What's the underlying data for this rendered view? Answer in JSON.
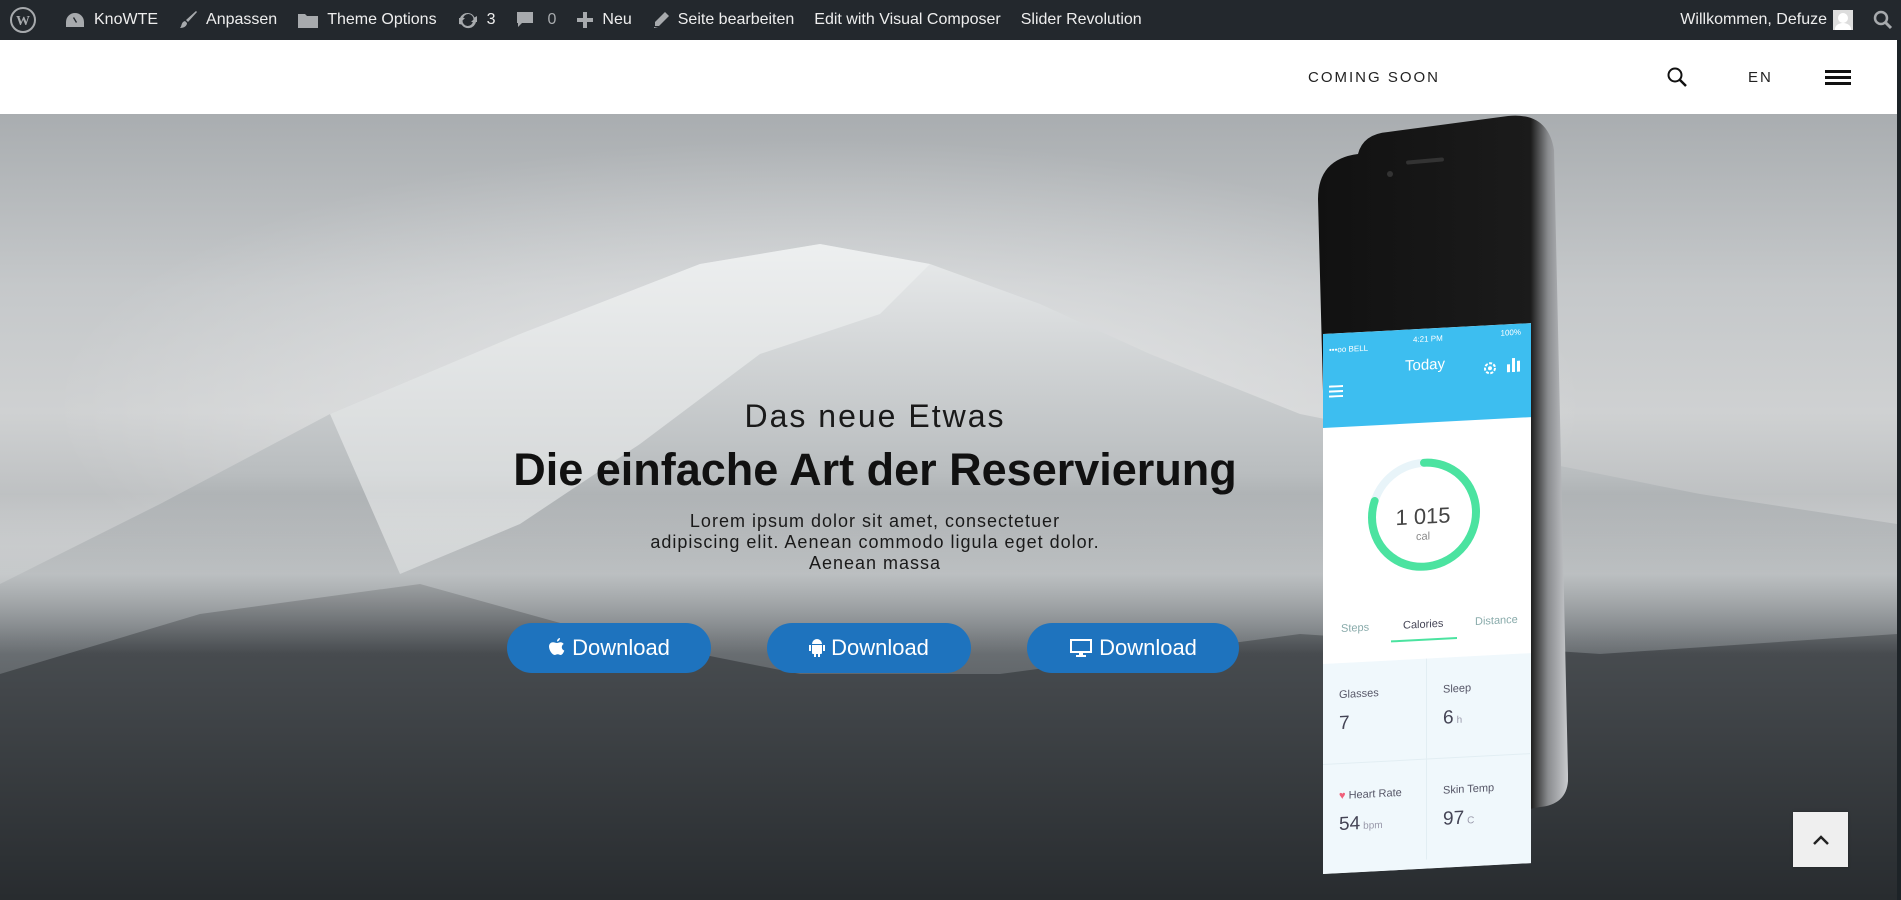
{
  "adminbar": {
    "site_name": "KnoWTE",
    "customize": "Anpassen",
    "theme_options": "Theme Options",
    "updates_count": "3",
    "comments_count": "0",
    "new": "Neu",
    "edit_page": "Seite bearbeiten",
    "visual_composer": "Edit with Visual Composer",
    "slider_revolution": "Slider Revolution",
    "greeting": "Willkommen, Defuze"
  },
  "header": {
    "nav_item": "COMING SOON",
    "language": "EN"
  },
  "hero": {
    "subtitle": "Das neue Etwas",
    "title": "Die einfache Art der Reservierung",
    "text_line1": "Lorem ipsum dolor sit amet, consectetuer",
    "text_line2": "adipiscing elit. Aenean commodo ligula eget dolor.",
    "text_line3": "Aenean massa",
    "buttons": [
      {
        "label": "Download",
        "icon": "apple-icon"
      },
      {
        "label": "Download",
        "icon": "android-icon"
      },
      {
        "label": "Download",
        "icon": "desktop-icon"
      }
    ]
  },
  "phone": {
    "status": "•••oo BELL",
    "time": "4:21 PM",
    "battery": "100%",
    "header_title": "Today",
    "calories_value": "1 015",
    "calories_unit": "cal",
    "calorie_progress": 0.8,
    "tabs": [
      "Steps",
      "Calories",
      "Distance"
    ],
    "stats": [
      {
        "label": "Glasses",
        "value": "7",
        "unit": ""
      },
      {
        "label": "Sleep",
        "value": "6",
        "unit": "h"
      },
      {
        "label": "Heart Rate",
        "value": "54",
        "unit": "bpm"
      },
      {
        "label": "Skin Temp",
        "value": "97",
        "unit": "C"
      }
    ]
  },
  "colors": {
    "adminbar": "#23282d",
    "button": "#1e73be",
    "phone_accent": "#3dbef0",
    "ring": "#4be3a0"
  }
}
